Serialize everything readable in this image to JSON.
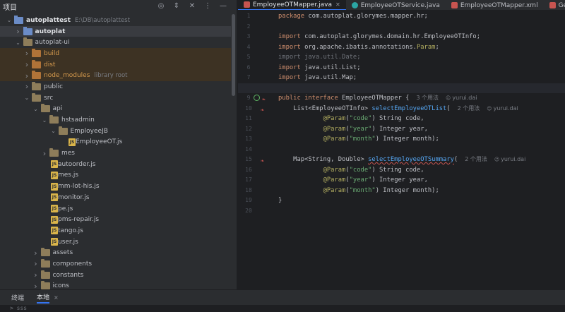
{
  "project": {
    "title": "项目",
    "tree": [
      {
        "depth": 0,
        "chevron": "v",
        "icon": "module",
        "name": "autoplattest",
        "hint": "E:\\DB\\autoplattest",
        "bold": true,
        "state": ""
      },
      {
        "depth": 1,
        "chevron": ">",
        "icon": "module",
        "name": "autoplat",
        "hint": "",
        "bold": true,
        "state": "sel"
      },
      {
        "depth": 1,
        "chevron": "v",
        "icon": "folder",
        "name": "autoplat-ui",
        "hint": "",
        "bold": false,
        "state": ""
      },
      {
        "depth": 2,
        "chevron": ">",
        "icon": "folder-orange",
        "name": "build",
        "hint": "",
        "bold": false,
        "state": "excluded"
      },
      {
        "depth": 2,
        "chevron": ">",
        "icon": "folder-orange",
        "name": "dist",
        "hint": "",
        "bold": false,
        "state": "excluded"
      },
      {
        "depth": 2,
        "chevron": ">",
        "icon": "folder-orange",
        "name": "node_modules",
        "hint": "library root",
        "bold": false,
        "state": "excluded"
      },
      {
        "depth": 2,
        "chevron": ">",
        "icon": "folder",
        "name": "public",
        "hint": "",
        "bold": false,
        "state": ""
      },
      {
        "depth": 2,
        "chevron": "v",
        "icon": "folder",
        "name": "src",
        "hint": "",
        "bold": false,
        "state": ""
      },
      {
        "depth": 3,
        "chevron": "v",
        "icon": "folder",
        "name": "api",
        "hint": "",
        "bold": false,
        "state": ""
      },
      {
        "depth": 4,
        "chevron": "v",
        "icon": "folder",
        "name": "hstsadmin",
        "hint": "",
        "bold": false,
        "state": ""
      },
      {
        "depth": 5,
        "chevron": "v",
        "icon": "folder",
        "name": "EmployeeJB",
        "hint": "",
        "bold": false,
        "state": ""
      },
      {
        "depth": 6,
        "chevron": "",
        "icon": "js",
        "name": "EmployeeOT.js",
        "hint": "",
        "bold": false,
        "state": ""
      },
      {
        "depth": 4,
        "chevron": ">",
        "icon": "folder",
        "name": "mes",
        "hint": "",
        "bold": false,
        "state": ""
      },
      {
        "depth": 4,
        "chevron": "",
        "icon": "js",
        "name": "autoorder.js",
        "hint": "",
        "bold": false,
        "state": ""
      },
      {
        "depth": 4,
        "chevron": "",
        "icon": "js",
        "name": "mes.js",
        "hint": "",
        "bold": false,
        "state": ""
      },
      {
        "depth": 4,
        "chevron": "",
        "icon": "js",
        "name": "mm-lot-his.js",
        "hint": "",
        "bold": false,
        "state": ""
      },
      {
        "depth": 4,
        "chevron": "",
        "icon": "js",
        "name": "monitor.js",
        "hint": "",
        "bold": false,
        "state": ""
      },
      {
        "depth": 4,
        "chevron": "",
        "icon": "js",
        "name": "pe.js",
        "hint": "",
        "bold": false,
        "state": ""
      },
      {
        "depth": 4,
        "chevron": "",
        "icon": "js",
        "name": "pms-repair.js",
        "hint": "",
        "bold": false,
        "state": ""
      },
      {
        "depth": 4,
        "chevron": "",
        "icon": "js",
        "name": "tango.js",
        "hint": "",
        "bold": false,
        "state": ""
      },
      {
        "depth": 4,
        "chevron": "",
        "icon": "js",
        "name": "user.js",
        "hint": "",
        "bold": false,
        "state": ""
      },
      {
        "depth": 3,
        "chevron": ">",
        "icon": "folder",
        "name": "assets",
        "hint": "",
        "bold": false,
        "state": ""
      },
      {
        "depth": 3,
        "chevron": ">",
        "icon": "folder",
        "name": "components",
        "hint": "",
        "bold": false,
        "state": ""
      },
      {
        "depth": 3,
        "chevron": ">",
        "icon": "folder",
        "name": "constants",
        "hint": "",
        "bold": false,
        "state": ""
      },
      {
        "depth": 3,
        "chevron": ">",
        "icon": "folder",
        "name": "icons",
        "hint": "",
        "bold": false,
        "state": ""
      }
    ]
  },
  "tabs": [
    {
      "label": "EmployeeOTMapper.java",
      "icon": "java",
      "active": true
    },
    {
      "label": "EmployeeOTService.java",
      "icon": "cls",
      "active": false
    },
    {
      "label": "EmployeeOTMapper.xml",
      "icon": "xml",
      "active": false
    },
    {
      "label": "GetMesL",
      "icon": "java",
      "active": false
    }
  ],
  "editor": {
    "line_numbers": [
      "1",
      "2",
      "3",
      "4",
      "5",
      "6",
      "7",
      "8",
      "9",
      "10",
      "11",
      "12",
      "13",
      "14",
      "15",
      "16",
      "17",
      "18",
      "19",
      "20"
    ],
    "lines": [
      [
        {
          "t": "kw",
          "s": "package "
        },
        {
          "t": "",
          "s": "com.autoplat.glorymes.mapper.hr;"
        }
      ],
      [],
      [
        {
          "t": "kw",
          "s": "import "
        },
        {
          "t": "",
          "s": "com.autoplat.glorymes.domain.hr.EmployeeOTInfo;"
        }
      ],
      [
        {
          "t": "kw",
          "s": "import "
        },
        {
          "t": "",
          "s": "org.apache.ibatis.annotations."
        },
        {
          "t": "ann",
          "s": "Param"
        },
        {
          "t": "",
          "s": ";"
        }
      ],
      [
        {
          "t": "dim",
          "s": "import java.util.Date;"
        }
      ],
      [
        {
          "t": "kw",
          "s": "import "
        },
        {
          "t": "",
          "s": "java.util.List;"
        }
      ],
      [
        {
          "t": "kw",
          "s": "import "
        },
        {
          "t": "",
          "s": "java.util.Map;"
        }
      ],
      [],
      [
        {
          "t": "kw",
          "s": "public interface "
        },
        {
          "t": "",
          "s": "EmployeeOTMapper {"
        },
        {
          "t": "inlay",
          "s": "3 个用法"
        },
        {
          "t": "inlay-user",
          "s": "yurui.dai"
        }
      ],
      [
        {
          "t": "",
          "s": "    List<EmployeeOTInfo> "
        },
        {
          "t": "fn",
          "s": "selectEmployeeOTList"
        },
        {
          "t": "",
          "s": "("
        },
        {
          "t": "inlay",
          "s": "2 个用法"
        },
        {
          "t": "inlay-user",
          "s": "yurui.dai"
        }
      ],
      [
        {
          "t": "",
          "s": "            "
        },
        {
          "t": "ann",
          "s": "@Param"
        },
        {
          "t": "",
          "s": "("
        },
        {
          "t": "str",
          "s": "\"code\""
        },
        {
          "t": "",
          "s": ") String code,"
        }
      ],
      [
        {
          "t": "",
          "s": "            "
        },
        {
          "t": "ann",
          "s": "@Param"
        },
        {
          "t": "",
          "s": "("
        },
        {
          "t": "str",
          "s": "\"year\""
        },
        {
          "t": "",
          "s": ") Integer year,"
        }
      ],
      [
        {
          "t": "",
          "s": "            "
        },
        {
          "t": "ann",
          "s": "@Param"
        },
        {
          "t": "",
          "s": "("
        },
        {
          "t": "str",
          "s": "\"month\""
        },
        {
          "t": "",
          "s": ") Integer month);"
        }
      ],
      [],
      [
        {
          "t": "",
          "s": "    Map<String, Double> "
        },
        {
          "t": "fn ul",
          "s": "selectEmployeeOTSummary"
        },
        {
          "t": "",
          "s": "("
        },
        {
          "t": "inlay",
          "s": "2 个用法"
        },
        {
          "t": "inlay-user",
          "s": "yurui.dai"
        }
      ],
      [
        {
          "t": "",
          "s": "            "
        },
        {
          "t": "ann",
          "s": "@Param"
        },
        {
          "t": "",
          "s": "("
        },
        {
          "t": "str",
          "s": "\"code\""
        },
        {
          "t": "",
          "s": ") String code,"
        }
      ],
      [
        {
          "t": "",
          "s": "            "
        },
        {
          "t": "ann",
          "s": "@Param"
        },
        {
          "t": "",
          "s": "("
        },
        {
          "t": "str",
          "s": "\"year\""
        },
        {
          "t": "",
          "s": ") Integer year,"
        }
      ],
      [
        {
          "t": "",
          "s": "            "
        },
        {
          "t": "ann",
          "s": "@Param"
        },
        {
          "t": "",
          "s": "("
        },
        {
          "t": "str",
          "s": "\"month\""
        },
        {
          "t": "",
          "s": ") Integer month);"
        }
      ],
      [
        {
          "t": "",
          "s": "}"
        }
      ],
      []
    ],
    "current_line": 8,
    "gutter_marks": {
      "9": "implemented-green",
      "10": "impl",
      "15": "impl"
    }
  },
  "bottom": {
    "tabs": [
      "终端",
      "本地"
    ],
    "close": "×",
    "terminal_text": "> sss"
  },
  "colors": {
    "accent": "#3574f0",
    "excluded": "#d69a4d",
    "keyword": "#cf8e6d",
    "string": "#6aab73",
    "function": "#56a8f5"
  }
}
